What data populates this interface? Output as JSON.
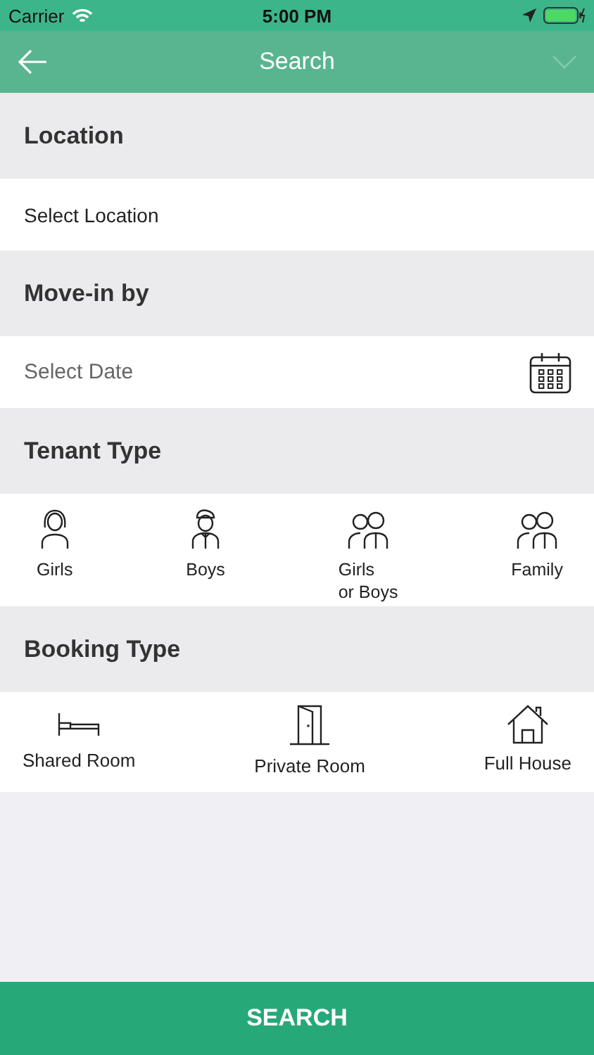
{
  "status_bar": {
    "carrier": "Carrier",
    "time": "5:00 PM"
  },
  "nav": {
    "title": "Search"
  },
  "location": {
    "heading": "Location",
    "value": "Select Location"
  },
  "move_in": {
    "heading": "Move-in by",
    "placeholder": "Select Date"
  },
  "tenant_type": {
    "heading": "Tenant Type",
    "options": [
      {
        "label": "Girls",
        "kind": "girl"
      },
      {
        "label": "Boys",
        "kind": "boy"
      },
      {
        "label": "Girls\nor Boys",
        "kind": "pair"
      },
      {
        "label": "Family",
        "kind": "pair"
      }
    ]
  },
  "booking_type": {
    "heading": "Booking Type",
    "options": [
      {
        "label": "Shared Room",
        "kind": "bed"
      },
      {
        "label": "Private Room",
        "kind": "door"
      },
      {
        "label": "Full House",
        "kind": "house"
      }
    ]
  },
  "search_button": "SEARCH"
}
